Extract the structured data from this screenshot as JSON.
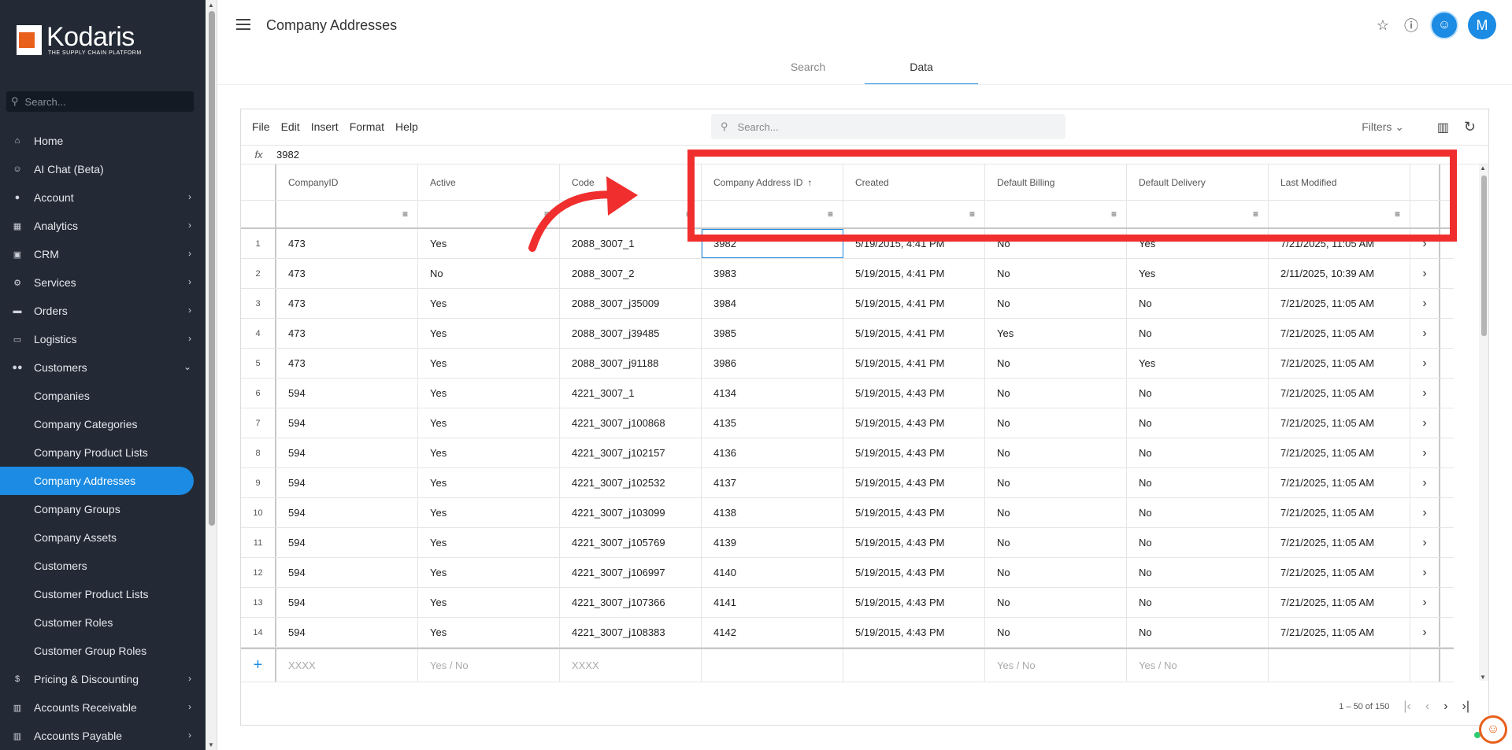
{
  "brand": {
    "name": "Kodaris",
    "tagline": "THE SUPPLY CHAIN PLATFORM"
  },
  "sidebar": {
    "search_placeholder": "Search...",
    "items": [
      {
        "label": "Home",
        "icon": "home-icon",
        "glyph": "⌂"
      },
      {
        "label": "AI Chat (Beta)",
        "icon": "robot-icon",
        "glyph": "☺"
      },
      {
        "label": "Account",
        "icon": "person-icon",
        "glyph": "●",
        "chevron": "›"
      },
      {
        "label": "Analytics",
        "icon": "chart-icon",
        "glyph": "▦",
        "chevron": "›"
      },
      {
        "label": "CRM",
        "icon": "contact-icon",
        "glyph": "▣",
        "chevron": "›"
      },
      {
        "label": "Services",
        "icon": "services-icon",
        "glyph": "⚙",
        "chevron": "›"
      },
      {
        "label": "Orders",
        "icon": "truck-icon",
        "glyph": "▬",
        "chevron": "›"
      },
      {
        "label": "Logistics",
        "icon": "shipping-icon",
        "glyph": "▭",
        "chevron": "›"
      },
      {
        "label": "Customers",
        "icon": "group-icon",
        "glyph": "●●",
        "chevron": "⌄"
      }
    ],
    "sub_items": [
      "Companies",
      "Company Categories",
      "Company Product Lists",
      "Company Addresses",
      "Company Groups",
      "Company Assets",
      "Customers",
      "Customer Product Lists",
      "Customer Roles",
      "Customer Group Roles"
    ],
    "active_sub": "Company Addresses",
    "bottom_items": [
      {
        "label": "Pricing & Discounting",
        "icon": "dollar-icon",
        "glyph": "$",
        "chevron": "›"
      },
      {
        "label": "Accounts Receivable",
        "icon": "bank-icon",
        "glyph": "▥",
        "chevron": "›"
      },
      {
        "label": "Accounts Payable",
        "icon": "bank-icon",
        "glyph": "▥",
        "chevron": "›"
      }
    ]
  },
  "header": {
    "title": "Company Addresses",
    "avatar_initial": "M"
  },
  "tabs": [
    "Search",
    "Data"
  ],
  "active_tab": "Data",
  "toolbar": {
    "menus": [
      "File",
      "Edit",
      "Insert",
      "Format",
      "Help"
    ],
    "search_placeholder": "Search...",
    "filters_label": "Filters"
  },
  "formula": {
    "label": "fx",
    "value": "3982"
  },
  "table": {
    "columns": [
      "CompanyID",
      "Active",
      "Code",
      "Company Address ID",
      "Created",
      "Default Billing",
      "Default Delivery",
      "Last Modified"
    ],
    "sorted_column": "Company Address ID",
    "rows": [
      {
        "n": "1",
        "cells": [
          "473",
          "Yes",
          "2088_3007_1",
          "3982",
          "5/19/2015, 4:41 PM",
          "No",
          "Yes",
          "7/21/2025, 11:05 AM"
        ]
      },
      {
        "n": "2",
        "cells": [
          "473",
          "No",
          "2088_3007_2",
          "3983",
          "5/19/2015, 4:41 PM",
          "No",
          "Yes",
          "2/11/2025, 10:39 AM"
        ]
      },
      {
        "n": "3",
        "cells": [
          "473",
          "Yes",
          "2088_3007_j35009",
          "3984",
          "5/19/2015, 4:41 PM",
          "No",
          "No",
          "7/21/2025, 11:05 AM"
        ]
      },
      {
        "n": "4",
        "cells": [
          "473",
          "Yes",
          "2088_3007_j39485",
          "3985",
          "5/19/2015, 4:41 PM",
          "Yes",
          "No",
          "7/21/2025, 11:05 AM"
        ]
      },
      {
        "n": "5",
        "cells": [
          "473",
          "Yes",
          "2088_3007_j91188",
          "3986",
          "5/19/2015, 4:41 PM",
          "No",
          "Yes",
          "7/21/2025, 11:05 AM"
        ]
      },
      {
        "n": "6",
        "cells": [
          "594",
          "Yes",
          "4221_3007_1",
          "4134",
          "5/19/2015, 4:43 PM",
          "No",
          "No",
          "7/21/2025, 11:05 AM"
        ]
      },
      {
        "n": "7",
        "cells": [
          "594",
          "Yes",
          "4221_3007_j100868",
          "4135",
          "5/19/2015, 4:43 PM",
          "No",
          "No",
          "7/21/2025, 11:05 AM"
        ]
      },
      {
        "n": "8",
        "cells": [
          "594",
          "Yes",
          "4221_3007_j102157",
          "4136",
          "5/19/2015, 4:43 PM",
          "No",
          "No",
          "7/21/2025, 11:05 AM"
        ]
      },
      {
        "n": "9",
        "cells": [
          "594",
          "Yes",
          "4221_3007_j102532",
          "4137",
          "5/19/2015, 4:43 PM",
          "No",
          "No",
          "7/21/2025, 11:05 AM"
        ]
      },
      {
        "n": "10",
        "cells": [
          "594",
          "Yes",
          "4221_3007_j103099",
          "4138",
          "5/19/2015, 4:43 PM",
          "No",
          "No",
          "7/21/2025, 11:05 AM"
        ]
      },
      {
        "n": "11",
        "cells": [
          "594",
          "Yes",
          "4221_3007_j105769",
          "4139",
          "5/19/2015, 4:43 PM",
          "No",
          "No",
          "7/21/2025, 11:05 AM"
        ]
      },
      {
        "n": "12",
        "cells": [
          "594",
          "Yes",
          "4221_3007_j106997",
          "4140",
          "5/19/2015, 4:43 PM",
          "No",
          "No",
          "7/21/2025, 11:05 AM"
        ]
      },
      {
        "n": "13",
        "cells": [
          "594",
          "Yes",
          "4221_3007_j107366",
          "4141",
          "5/19/2015, 4:43 PM",
          "No",
          "No",
          "7/21/2025, 11:05 AM"
        ]
      },
      {
        "n": "14",
        "cells": [
          "594",
          "Yes",
          "4221_3007_j108383",
          "4142",
          "5/19/2015, 4:43 PM",
          "No",
          "No",
          "7/21/2025, 11:05 AM"
        ]
      }
    ],
    "new_row_placeholders": [
      "XXXX",
      "Yes / No",
      "XXXX",
      "",
      "",
      "Yes / No",
      "Yes / No",
      ""
    ]
  },
  "pager": {
    "range": "1 – 50 of 150"
  },
  "colors": {
    "accent": "#1b8be3",
    "sidebar_bg": "#232a36",
    "annotation": "#f02e2e",
    "brand_orange": "#e8601c"
  }
}
